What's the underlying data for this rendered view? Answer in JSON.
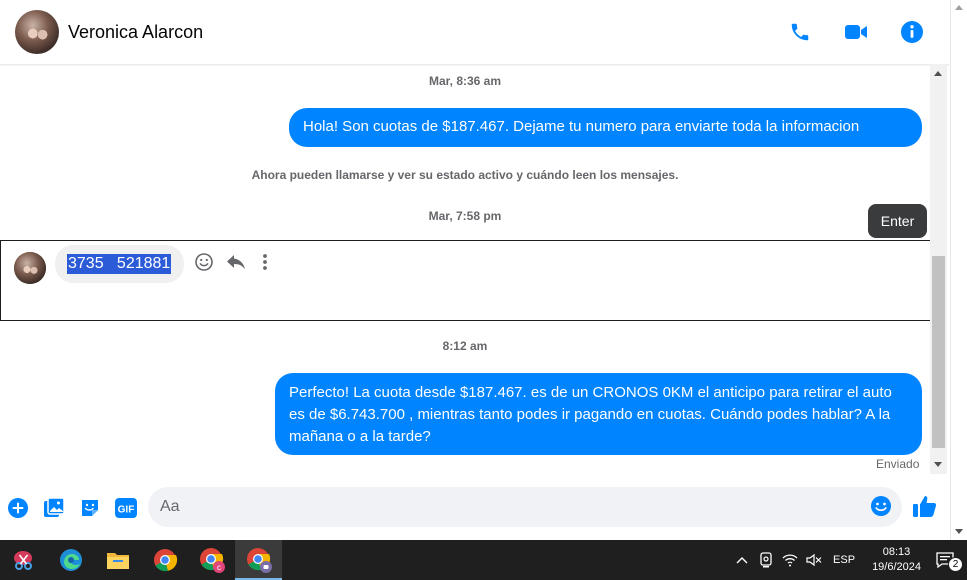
{
  "header": {
    "contact_name": "Veronica Alarcon",
    "actions": [
      "phone-icon",
      "video-camera-icon",
      "info-icon"
    ]
  },
  "messages": {
    "timestamp_1": "Mar, 8:36 am",
    "outgoing_1": "Hola! Son cuotas de $187.467. Dejame tu numero para enviarte toda la informacion",
    "system_note": "Ahora pueden llamarse y ver su estado activo y cuándo leen los mensajes.",
    "timestamp_2": "Mar, 7:58 pm",
    "tooltip": "Enter",
    "incoming_1": "3735   521881",
    "timestamp_3": "8:12 am",
    "outgoing_2": "Perfecto! La cuota desde $187.467. es de un CRONOS 0KM el anticipo para retirar el auto es de $6.743.700 , mientras tanto podes ir pagando en cuotas. Cuándo podes hablar? A la mañana o a la tarde?",
    "sent_status": "Enviado"
  },
  "composer": {
    "placeholder": "Aa",
    "icons": [
      "add-icon",
      "photo-icon",
      "sticker-icon",
      "gif-icon",
      "emoji-icon",
      "thumbs-up-icon"
    ],
    "gif_label": "GIF"
  },
  "taskbar": {
    "apps": [
      "snipping-tool-icon",
      "edge-icon",
      "file-explorer-icon",
      "chrome-icon",
      "chrome-profile-icon",
      "chrome-active-icon"
    ],
    "language": "ESP",
    "time": "08:13",
    "date": "19/6/2024",
    "notification_count": "2"
  },
  "colors": {
    "messenger_blue": "#0084ff",
    "incoming_bubble": "#f0f0f0",
    "taskbar": "#1f1f1f"
  }
}
